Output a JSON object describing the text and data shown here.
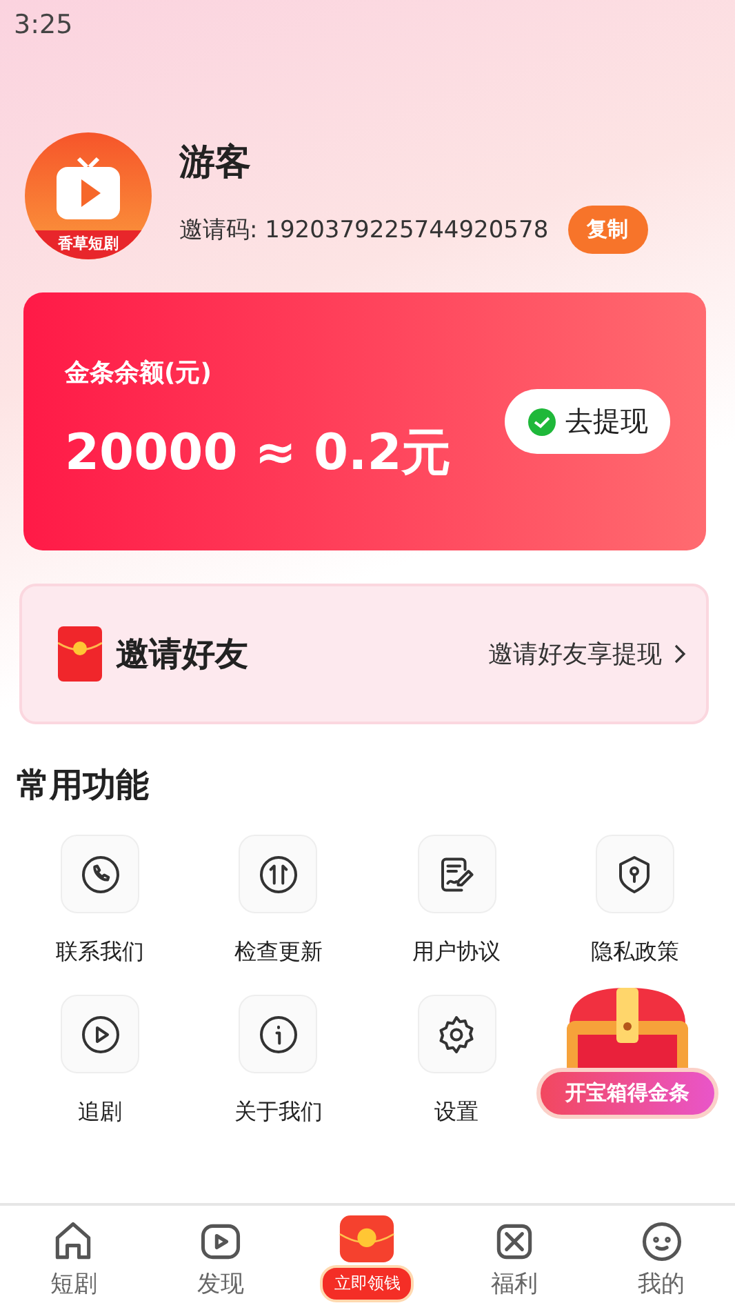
{
  "status_bar": {
    "time": "3:25"
  },
  "profile": {
    "logo_text": "香草短剧",
    "name": "游客",
    "invite_code": "邀请码: 1920379225744920578",
    "copy_button": "复制"
  },
  "balance_card": {
    "title": "金条余额(元)",
    "amount": "20000 ≈ 0.2元",
    "withdraw_button": "去提现"
  },
  "invite_card": {
    "title": "邀请好友",
    "link": "邀请好友享提现"
  },
  "functions": {
    "title": "常用功能",
    "items": [
      {
        "label": "联系我们",
        "kind": "phone"
      },
      {
        "label": "检查更新",
        "kind": "update"
      },
      {
        "label": "用户协议",
        "kind": "agreement"
      },
      {
        "label": "隐私政策",
        "kind": "privacy"
      },
      {
        "label": "追剧",
        "kind": "play"
      },
      {
        "label": "关于我们",
        "kind": "info"
      },
      {
        "label": "设置",
        "kind": "settings"
      }
    ]
  },
  "treasure": {
    "button": "开宝箱得金条"
  },
  "bottom_nav": [
    {
      "label": "短剧",
      "kind": "home"
    },
    {
      "label": "发现",
      "kind": "discover"
    },
    {
      "label": "立即领钱",
      "kind": "reward"
    },
    {
      "label": "福利",
      "kind": "welfare"
    },
    {
      "label": "我的",
      "kind": "me"
    }
  ]
}
